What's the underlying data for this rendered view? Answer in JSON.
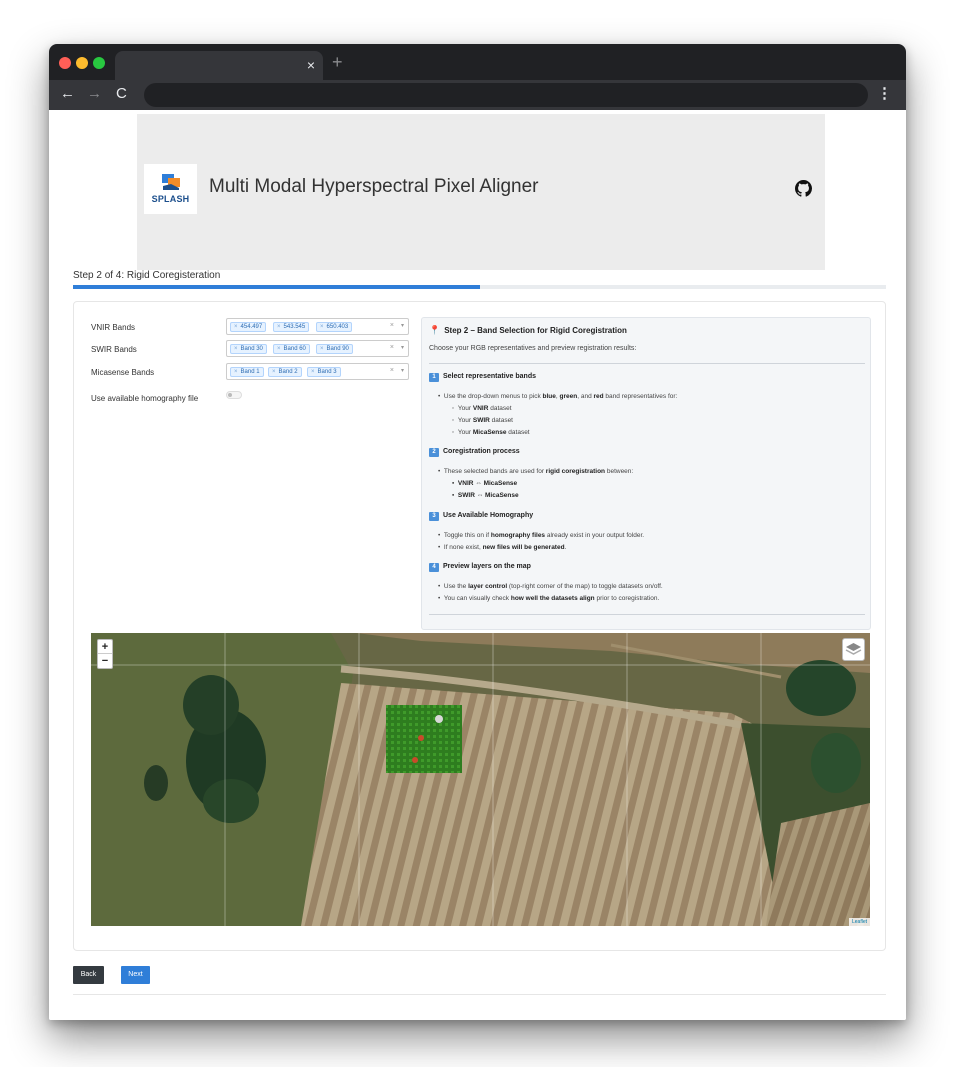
{
  "browser": {
    "tab_close": "×",
    "new_tab": "+",
    "nav_back": "←",
    "nav_forward": "→",
    "nav_reload": "C",
    "menu": "⋮"
  },
  "header": {
    "logo_text": "SPLASH",
    "title": "Multi Modal Hyperspectral Pixel Aligner",
    "github_icon": "github-icon"
  },
  "step": {
    "label": "Step 2 of 4: Rigid Coregisteration",
    "progress_fraction": 0.5
  },
  "form": {
    "vnir": {
      "label": "VNIR Bands",
      "chips": [
        "454.497",
        "543.545",
        "650.403"
      ]
    },
    "swir": {
      "label": "SWIR Bands",
      "chips": [
        "Band 30",
        "Band 60",
        "Band 90"
      ]
    },
    "micasense": {
      "label": "Micasense Bands",
      "chips": [
        "Band 1",
        "Band 2",
        "Band 3"
      ]
    },
    "homography": {
      "label": "Use available homography file",
      "enabled": false
    },
    "chip_remove": "×",
    "clear": "×",
    "arrow": "▾"
  },
  "instructions": {
    "title": "Step 2 – Band Selection for Rigid Coregistration",
    "intro": "Choose your RGB representatives and preview registration results:",
    "s1": {
      "num": "1",
      "head": "Select representative bands",
      "l1a": "Use the drop-down menus to pick ",
      "l1b": "blue",
      "l1c": ", ",
      "l1d": "green",
      "l1e": ", and ",
      "l1f": "red",
      "l1g": " band representatives for:",
      "y1a": "Your ",
      "y1b": "VNIR",
      "y1c": " dataset",
      "y2a": "Your ",
      "y2b": "SWIR",
      "y2c": " dataset",
      "y3a": "Your ",
      "y3b": "MicaSense",
      "y3c": " dataset"
    },
    "s2": {
      "num": "2",
      "head": "Coregistration process",
      "l1a": "These selected bands are used for ",
      "l1b": "rigid coregistration",
      "l1c": " between:",
      "p1": "VNIR ⇔ MicaSense",
      "p2": "SWIR ⇔ MicaSense"
    },
    "s3": {
      "num": "3",
      "head": "Use Available Homography",
      "l1a": "Toggle this on if ",
      "l1b": "homography files",
      "l1c": " already exist in your output folder.",
      "l2a": "If none exist, ",
      "l2b": "new files will be generated",
      "l2c": "."
    },
    "s4": {
      "num": "4",
      "head": "Preview layers on the map",
      "l1a": "Use the ",
      "l1b": "layer control",
      "l1c": " (top-right corner of the map) to toggle datasets on/off.",
      "l2a": "You can visually check ",
      "l2b": "how well the datasets align",
      "l2c": " prior to coregistration."
    }
  },
  "map": {
    "zoom_in": "+",
    "zoom_out": "−",
    "attribution": "Leaflet"
  },
  "buttons": {
    "back": "Back",
    "next": "Next"
  }
}
